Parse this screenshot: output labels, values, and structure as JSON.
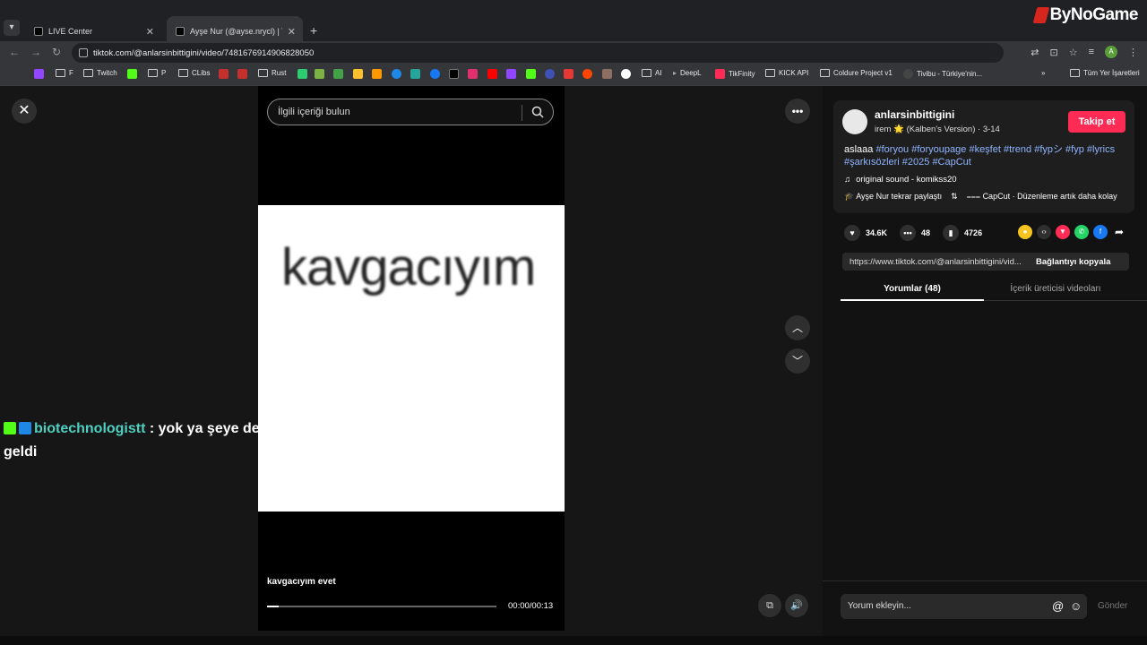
{
  "browser": {
    "tabs": [
      {
        "title": "LIVE Center"
      },
      {
        "title": "Ayşe Nur (@ayse.nrycl) | Tik"
      }
    ],
    "brand": "ByNoGame",
    "url": "tiktok.com/@anlarsinbittigini/video/7481676914906828050",
    "bookmarks": [
      "F",
      "Twitch",
      "P",
      "CLibs",
      "Rust",
      "AI",
      "DeepL",
      "TikFinity",
      "KICK API",
      "Coldure Project v1",
      "Tivibu - Türkiye'nin...",
      "Tüm Yer İşaretleri"
    ],
    "profile_initial": "A"
  },
  "video": {
    "search_placeholder": "İlgili içeriği bulun",
    "frame_text": "kavgacıyım",
    "caption": "kavgacıyım evet",
    "time": "00:00/00:13",
    "progress": 0.05
  },
  "chat_overlay": {
    "user": "biotechnologistt",
    "message": " : yok ya şeye denk geldi"
  },
  "panel": {
    "author": "anlarsinbittigini",
    "subtitle": "irem 🌟 (Kalben's Version) · 3-14",
    "follow_label": "Takip et",
    "desc_prefix": "aslaaa ",
    "hashtags": "#foryou #foryoupage #keşfet #trend #fypシ #fyp #lyrics #şarkısözleri #2025 #CapCut",
    "sound": "original sound - komikss20",
    "repost": "Ayşe Nur tekrar paylaştı",
    "capcut": "CapCut · Düzenleme artık daha kolay",
    "likes": "34.6K",
    "comments": "48",
    "saves": "4726",
    "link": "https://www.tiktok.com/@anlarsinbittigini/vid...",
    "copy_label": "Bağlantıyı kopyala",
    "tab_comments": "Yorumlar (48)",
    "tab_videos": "İçerik üreticisi videoları",
    "comment_placeholder": "Yorum ekleyin...",
    "send_label": "Gönder"
  }
}
